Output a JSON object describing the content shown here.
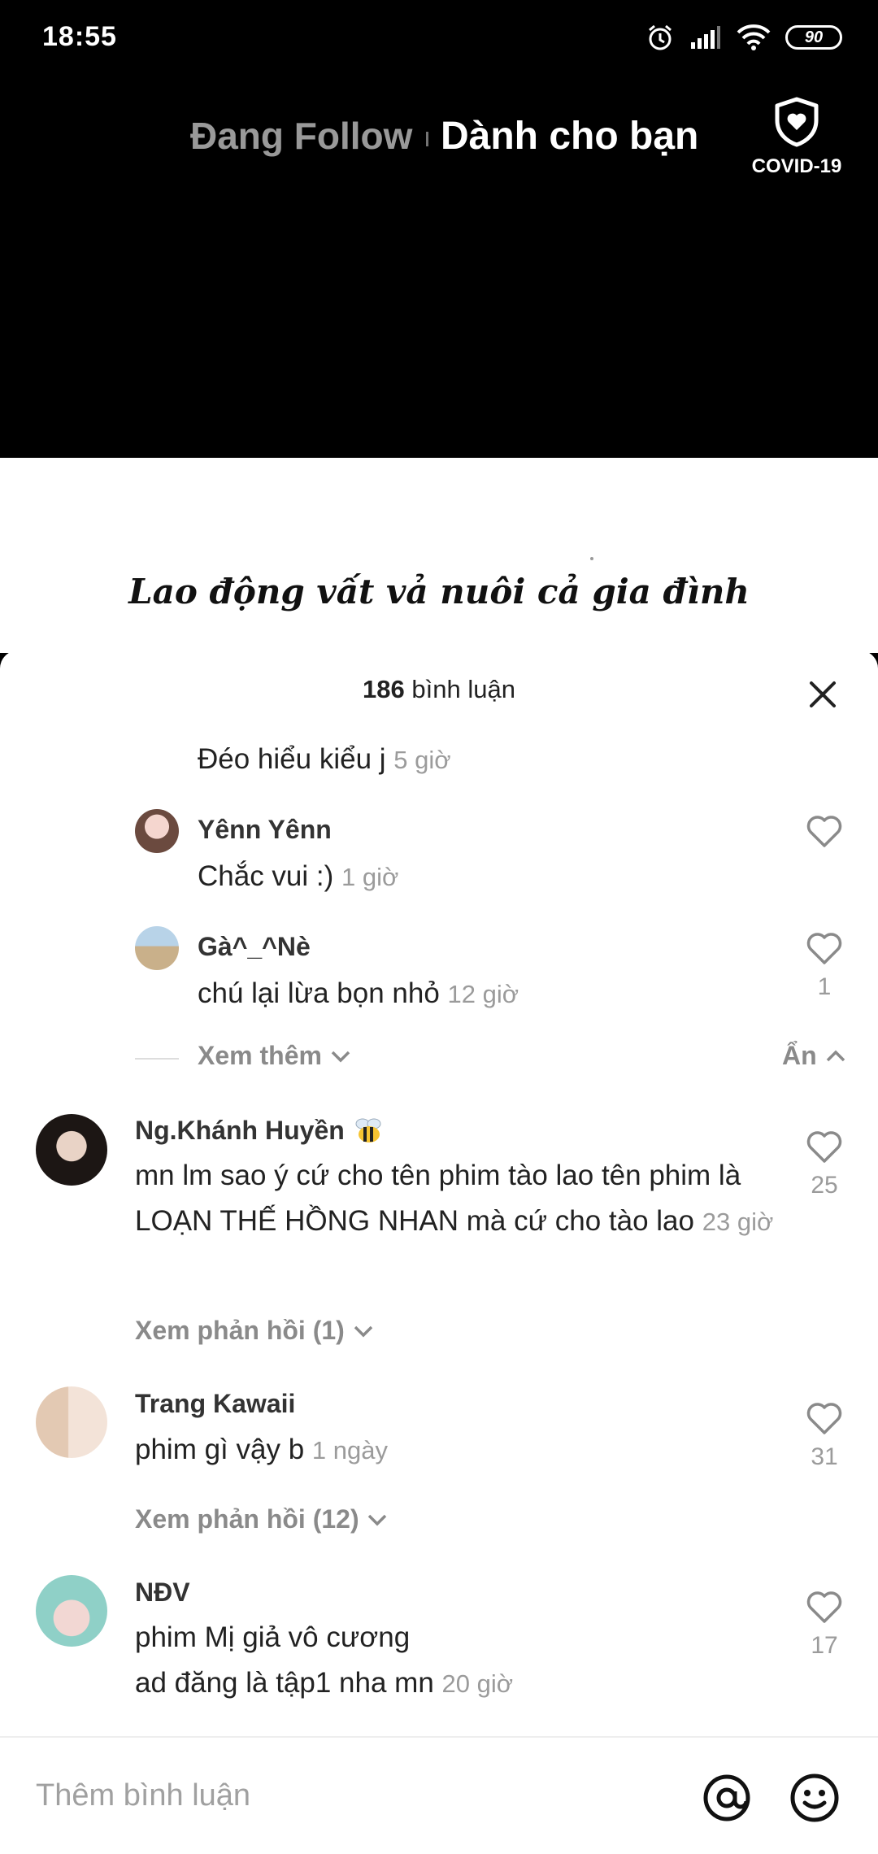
{
  "status_bar": {
    "time": "18:55",
    "battery": "90"
  },
  "top_nav": {
    "following": "Đang Follow",
    "for_you": "Dành cho bạn",
    "covid_label": "COVID-19"
  },
  "video": {
    "caption": "Lao động vất vả nuôi cả gia đình"
  },
  "comments_header": {
    "count": "186",
    "label": " bình luận"
  },
  "comments": [
    {
      "username": "",
      "text": "Đéo hiểu kiểu j",
      "time": "5 giờ",
      "likes": ""
    },
    {
      "username": "Yênn Yênn",
      "text": "Chắc vui :)",
      "time": "1 giờ",
      "likes": ""
    },
    {
      "username": "Gà^_^Nè",
      "text": "chú lại lừa bọn nhỏ",
      "time": "12 giờ",
      "likes": "1"
    },
    {
      "username": "Ng.Khánh Huyền",
      "text": "mn lm sao ý cứ cho tên phim tào lao tên phim là LOẠN THẾ HỒNG NHAN mà cứ cho tào lao",
      "time": "23 giờ",
      "likes": "25"
    },
    {
      "username": "Trang Kawaii",
      "text": "phim gì vậy b",
      "time": "1 ngày",
      "likes": "31"
    },
    {
      "username": "NĐV",
      "text_line1": "phim Mị giả vô cương",
      "text_line2": "ad đăng là tập1 nha mn",
      "time": "20 giờ",
      "likes": "17"
    }
  ],
  "replies": {
    "view_more": "Xem thêm",
    "hide": "Ẩn",
    "view_replies_1": "Xem phản hồi (1)",
    "view_replies_12": "Xem phản hồi (12)"
  },
  "input": {
    "placeholder": "Thêm bình luận"
  },
  "icons": {
    "close": "close-icon",
    "heart": "heart-icon",
    "mention": "at-icon",
    "emoji": "emoji-icon",
    "shield": "shield-heart-icon",
    "bee": "bee-emoji"
  },
  "colors": {
    "secondary_text": "#9b9b9b",
    "primary_text": "#222222"
  }
}
